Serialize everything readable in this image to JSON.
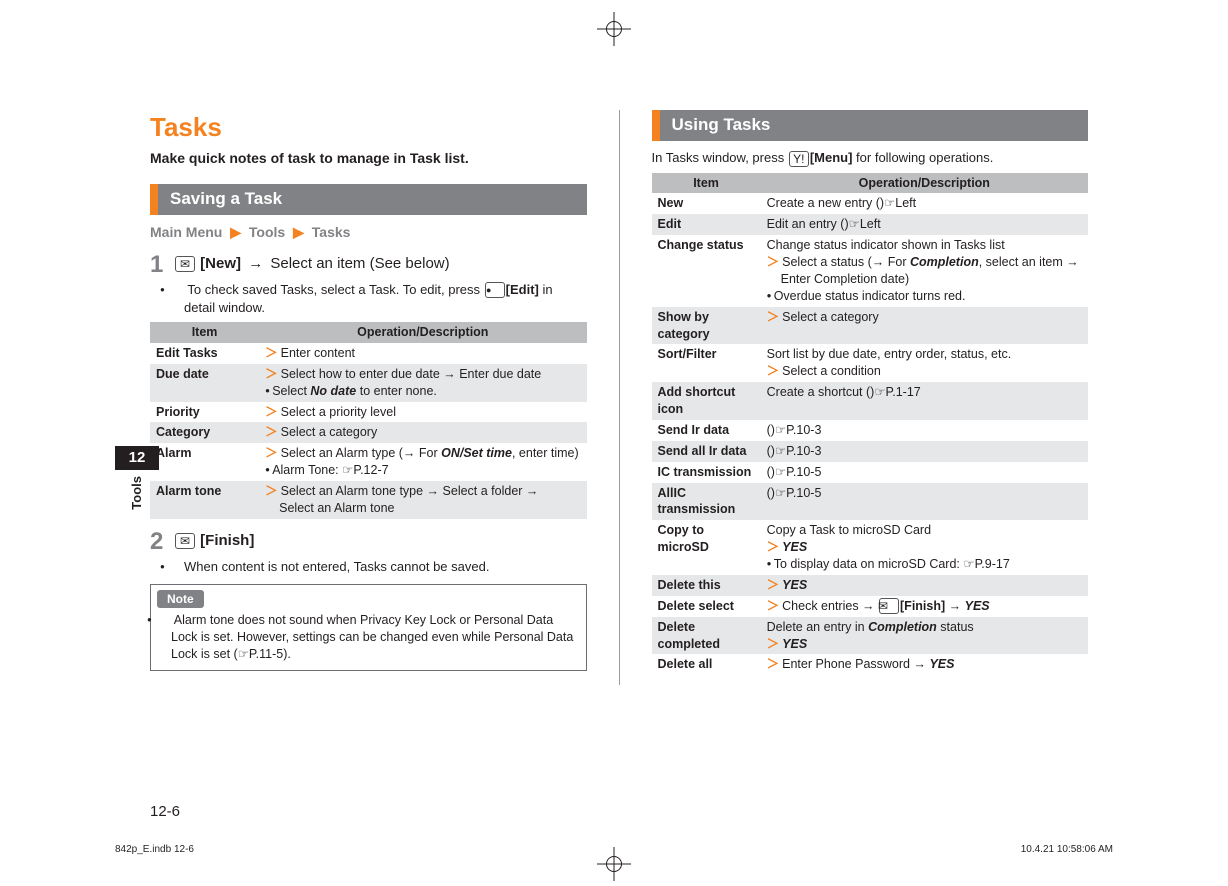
{
  "sideTab": {
    "chapter": "12",
    "section": "Tools"
  },
  "pageNumber": "12-6",
  "footer": {
    "left": "842p_E.indb   12-6",
    "right": "10.4.21   10:58:06 AM"
  },
  "left": {
    "title": "Tasks",
    "subtitle": "Make quick notes of task to manage in Task list.",
    "section": "Saving a Task",
    "breadcrumb": {
      "a": "Main Menu",
      "b": "Tools",
      "c": "Tasks",
      "sep": "▶"
    },
    "step1": {
      "num": "1",
      "new": "[New]",
      "arrow": "→",
      "tail": "Select an item (See below)",
      "sub1_a": "To check saved Tasks, select a Task. To edit, press ",
      "sub1_key": "[Edit]",
      "sub1_b": " in detail window."
    },
    "table1": {
      "headItem": "Item",
      "headDesc": "Operation/Description",
      "rows": [
        {
          "item": "Edit Tasks",
          "desc": [
            {
              "chev": true,
              "text": "Enter content"
            }
          ]
        },
        {
          "item": "Due date",
          "desc": [
            {
              "chev": true,
              "text": "Select how to enter due date → Enter due date"
            },
            {
              "bullet": true,
              "text": "Select ",
              "bi": "No date",
              "tail": " to enter none."
            }
          ]
        },
        {
          "item": "Priority",
          "desc": [
            {
              "chev": true,
              "text": "Select a priority level"
            }
          ]
        },
        {
          "item": "Category",
          "desc": [
            {
              "chev": true,
              "text": "Select a category"
            }
          ]
        },
        {
          "item": "Alarm",
          "desc": [
            {
              "chev": true,
              "text": "Select an Alarm type (→ For ",
              "bi": "ON/Set time",
              "tail": ", enter time)"
            },
            {
              "bullet": true,
              "text": "Alarm Tone: ",
              "ref": "☞P.12-7"
            }
          ]
        },
        {
          "item": "Alarm tone",
          "desc": [
            {
              "chev": true,
              "text": "Select an Alarm tone type → Select a folder → "
            },
            {
              "cont": true,
              "text": "Select an Alarm tone"
            }
          ]
        }
      ]
    },
    "step2": {
      "num": "2",
      "finish": "[Finish]",
      "sub": "When content is not entered, Tasks cannot be saved."
    },
    "note": {
      "label": "Note",
      "text1": "Alarm tone does not sound when Privacy Key Lock or Personal Data Lock is set. However, settings can be changed even while Personal Data Lock is set (",
      "ref": "☞P.11-5",
      "text2": ")."
    }
  },
  "right": {
    "section": "Using Tasks",
    "intro_a": "In Tasks window, press ",
    "intro_key": "[Menu]",
    "intro_b": " for following operations.",
    "table": {
      "headItem": "Item",
      "headDesc": "Operation/Description",
      "rows": [
        {
          "item": "New",
          "desc": [
            {
              "plain": true,
              "text": "Create a new entry (",
              "ref": "☞Left",
              "tail": ")"
            }
          ]
        },
        {
          "item": "Edit",
          "desc": [
            {
              "plain": true,
              "text": "Edit an entry (",
              "ref": "☞Left",
              "tail": ")"
            }
          ]
        },
        {
          "item": "Change status",
          "desc": [
            {
              "plain": true,
              "text": "Change status indicator shown in Tasks list"
            },
            {
              "chev": true,
              "text": "Select a status (→ For ",
              "bi": "Completion",
              "tail": ", select an item → "
            },
            {
              "cont": true,
              "text": "Enter Completion date)"
            },
            {
              "bullet": true,
              "text": "Overdue status indicator turns red."
            }
          ]
        },
        {
          "item": "Show by category",
          "desc": [
            {
              "chev": true,
              "text": "Select a category"
            }
          ]
        },
        {
          "item": "Sort/Filter",
          "desc": [
            {
              "plain": true,
              "text": "Sort list by due date, entry order, status, etc."
            },
            {
              "chev": true,
              "text": "Select a condition"
            }
          ]
        },
        {
          "item": "Add shortcut icon",
          "desc": [
            {
              "plain": true,
              "text": "Create a shortcut (",
              "ref": "☞P.1-17",
              "tail": ")"
            }
          ]
        },
        {
          "item": "Send Ir data",
          "desc": [
            {
              "plain": true,
              "text": "(",
              "ref": "☞P.10-3",
              "tail": ")"
            }
          ]
        },
        {
          "item": "Send all Ir data",
          "desc": [
            {
              "plain": true,
              "text": "(",
              "ref": "☞P.10-3",
              "tail": ")"
            }
          ]
        },
        {
          "item": "IC transmission",
          "desc": [
            {
              "plain": true,
              "text": "(",
              "ref": "☞P.10-5",
              "tail": ")"
            }
          ]
        },
        {
          "item": "AllIC transmission",
          "desc": [
            {
              "plain": true,
              "text": "(",
              "ref": "☞P.10-5",
              "tail": ")"
            }
          ]
        },
        {
          "item": "Copy to microSD",
          "desc": [
            {
              "plain": true,
              "text": "Copy a Task to microSD Card"
            },
            {
              "chev": true,
              "bi": "YES"
            },
            {
              "bullet": true,
              "text": "To display data on microSD Card: ",
              "ref": "☞P.9-17"
            }
          ]
        },
        {
          "item": "Delete this",
          "desc": [
            {
              "chev": true,
              "bi": "YES"
            }
          ]
        },
        {
          "item": "Delete select",
          "desc": [
            {
              "chev": true,
              "text": "Check entries → ",
              "key": "✉",
              "softkey": "[Finish]",
              "tail2": " → ",
              "bi": "YES"
            }
          ]
        },
        {
          "item": "Delete completed",
          "desc": [
            {
              "plain": true,
              "text": "Delete an entry in ",
              "bi": "Completion",
              "tail": " status"
            },
            {
              "chev": true,
              "bi": "YES"
            }
          ]
        },
        {
          "item": "Delete all",
          "desc": [
            {
              "chev": true,
              "text": "Enter Phone Password → ",
              "bi": "YES"
            }
          ]
        }
      ]
    }
  }
}
